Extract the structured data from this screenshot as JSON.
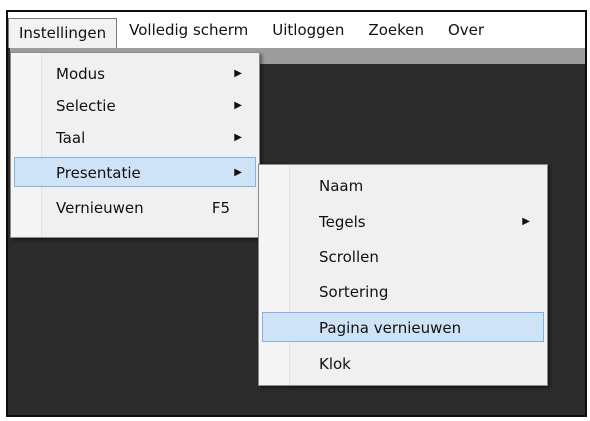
{
  "menubar": {
    "items": [
      {
        "label": "Instellingen"
      },
      {
        "label": "Volledig scherm"
      },
      {
        "label": "Uitloggen"
      },
      {
        "label": "Zoeken"
      },
      {
        "label": "Over"
      }
    ]
  },
  "menu_instellingen": {
    "items": [
      {
        "label": "Modus",
        "submenu_icon": "triangle-right-icon"
      },
      {
        "label": "Selectie",
        "submenu_icon": "triangle-right-icon"
      },
      {
        "label": "Taal",
        "submenu_icon": "triangle-right-icon"
      },
      {
        "label": "Presentatie",
        "submenu_icon": "triangle-right-icon",
        "highlighted": true
      },
      {
        "label": "Vernieuwen",
        "shortcut": "F5"
      }
    ]
  },
  "menu_presentatie": {
    "items": [
      {
        "label": "Naam"
      },
      {
        "label": "Tegels",
        "submenu_icon": "triangle-right-icon"
      },
      {
        "label": "Scrollen"
      },
      {
        "label": "Sortering"
      },
      {
        "label": "Pagina vernieuwen",
        "highlighted": true
      },
      {
        "label": "Klok"
      }
    ]
  },
  "colors": {
    "highlight_bg": "#cfe3f7",
    "highlight_border": "#84b3e3",
    "window_bg": "#2b2b2b",
    "strip": "#9d9d9d"
  }
}
